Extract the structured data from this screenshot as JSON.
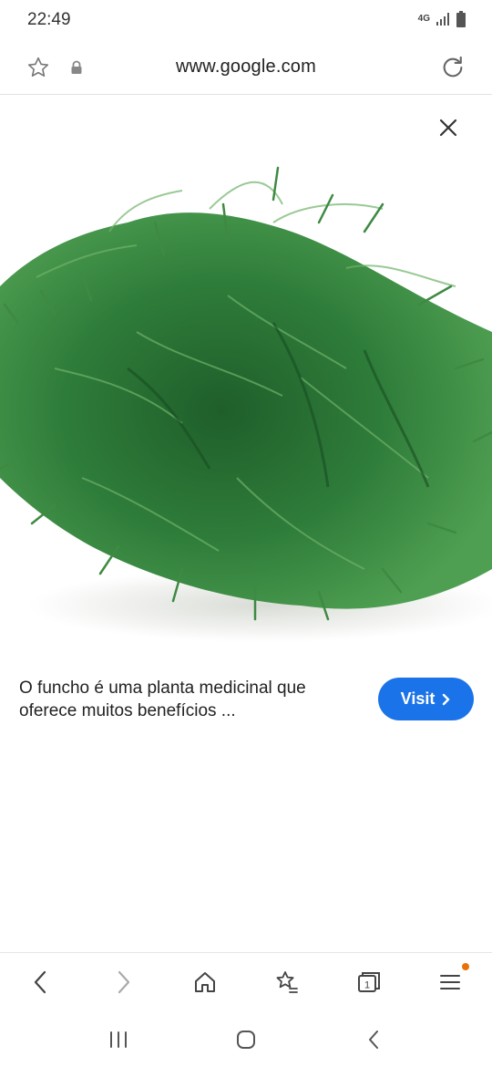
{
  "status_bar": {
    "time": "22:49",
    "network": "4G"
  },
  "browser": {
    "url": "www.google.com"
  },
  "preview": {
    "caption": "O funcho é uma planta medicinal que oferece muitos benefícios ...",
    "visit_label": "Visit"
  },
  "colors": {
    "accent": "#1a73e8",
    "leaf": "#2f7d3a",
    "notification": "#e8710a"
  },
  "icons": {
    "bookmark": "star-icon",
    "secure": "lock-icon",
    "reload": "reload-icon",
    "close": "close-icon",
    "nav": [
      "back-icon",
      "forward-icon",
      "home-icon",
      "bookmarks-icon",
      "tabs-icon",
      "menu-icon"
    ],
    "system": [
      "recents-icon",
      "home-circle-icon",
      "system-back-icon"
    ]
  },
  "tabs_count": "1"
}
